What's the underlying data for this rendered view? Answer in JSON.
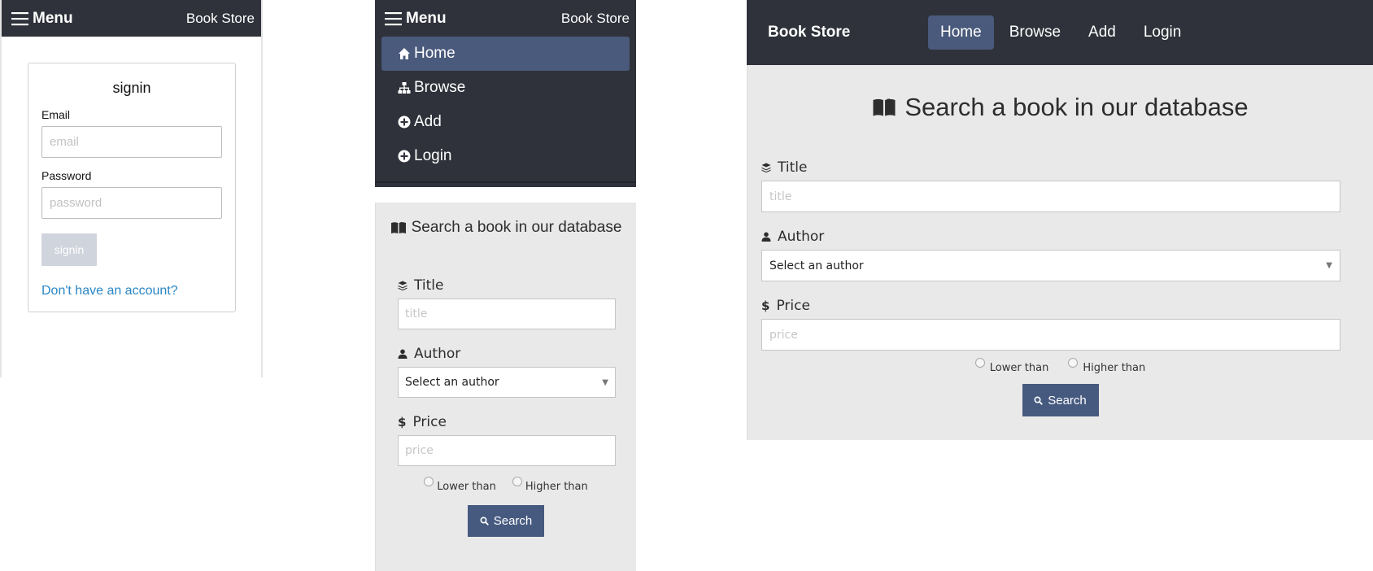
{
  "mobile_signin": {
    "menu_label": "Menu",
    "brand": "Book Store",
    "card_title": "signin",
    "email_label": "Email",
    "email_placeholder": "email",
    "password_label": "Password",
    "password_placeholder": "password",
    "submit_label": "signin",
    "signup_link": "Don't have an account?"
  },
  "mobile_menu": {
    "menu_label": "Menu",
    "brand": "Book Store",
    "items": [
      {
        "label": "Home",
        "icon": "home-icon",
        "active": true
      },
      {
        "label": "Browse",
        "icon": "sitemap-icon",
        "active": false
      },
      {
        "label": "Add",
        "icon": "plus-circle-icon",
        "active": false
      },
      {
        "label": "Login",
        "icon": "plus-circle-icon",
        "active": false
      }
    ]
  },
  "search": {
    "heading": "Search a book in our database",
    "title_label": "Title",
    "title_placeholder": "title",
    "author_label": "Author",
    "author_selected": "Select an author",
    "price_label": "Price",
    "price_placeholder": "price",
    "lower_label": "Lower than",
    "higher_label": "Higher than",
    "search_button": "Search"
  },
  "desktop_nav": {
    "brand": "Book Store",
    "items": [
      {
        "label": "Home",
        "active": true
      },
      {
        "label": "Browse",
        "active": false
      },
      {
        "label": "Add",
        "active": false
      },
      {
        "label": "Login",
        "active": false
      }
    ]
  },
  "colors": {
    "navbar": "#2f323a",
    "active": "#4a5a7c",
    "button": "#465a80",
    "link": "#2a86c4",
    "form_bg": "#e9e9e9"
  }
}
